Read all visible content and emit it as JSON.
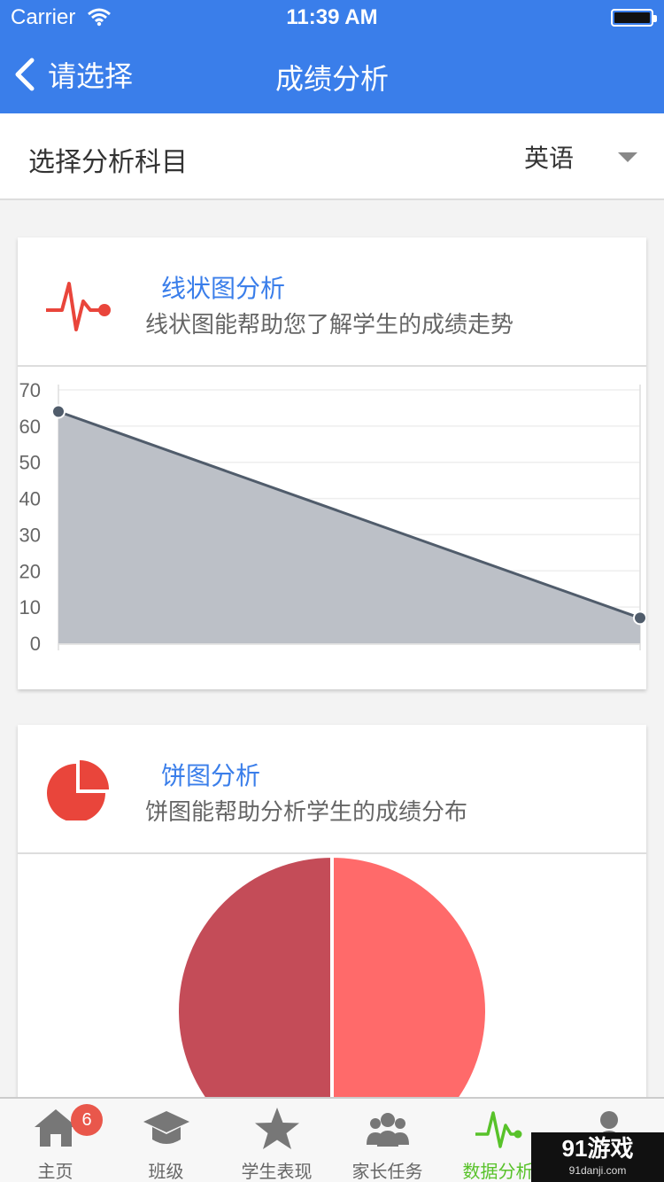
{
  "status": {
    "carrier": "Carrier",
    "time": "11:39 AM"
  },
  "nav": {
    "back_label": "请选择",
    "title": "成绩分析"
  },
  "subject": {
    "label": "选择分析科目",
    "value": "英语"
  },
  "line_card": {
    "title": "线状图分析",
    "description": "线状图能帮助您了解学生的成绩走势"
  },
  "pie_card": {
    "title": "饼图分析",
    "description": "饼图能帮助分析学生的成绩分布"
  },
  "tabs": [
    {
      "label": "主页",
      "icon": "home-icon",
      "badge": "6"
    },
    {
      "label": "班级",
      "icon": "graduation-cap-icon"
    },
    {
      "label": "学生表现",
      "icon": "star-icon"
    },
    {
      "label": "家长任务",
      "icon": "group-icon"
    },
    {
      "label": "数据分析",
      "icon": "pulse-icon",
      "active": true
    },
    {
      "label": "我的",
      "icon": "person-icon"
    }
  ],
  "watermark": {
    "main": "91游戏",
    "sub": "91danji.com"
  },
  "colors": {
    "primary": "#3a7eea",
    "accent_red": "#e9453b",
    "active_tab": "#58c22a",
    "line": "#505c6b",
    "area": "#bcc0c7",
    "pie_a": "#c44c58",
    "pie_b": "#ff6a6a"
  },
  "chart_data": [
    {
      "type": "area",
      "title": "",
      "x": [
        1,
        2
      ],
      "series": [
        {
          "values": [
            64,
            7
          ]
        }
      ],
      "ylim": [
        0,
        70
      ],
      "yticks": [
        0,
        10,
        20,
        30,
        40,
        50,
        60,
        70
      ],
      "grid": true
    },
    {
      "type": "pie",
      "values": [
        50,
        50
      ],
      "colors": [
        "#c44c58",
        "#ff6a6a"
      ]
    }
  ]
}
